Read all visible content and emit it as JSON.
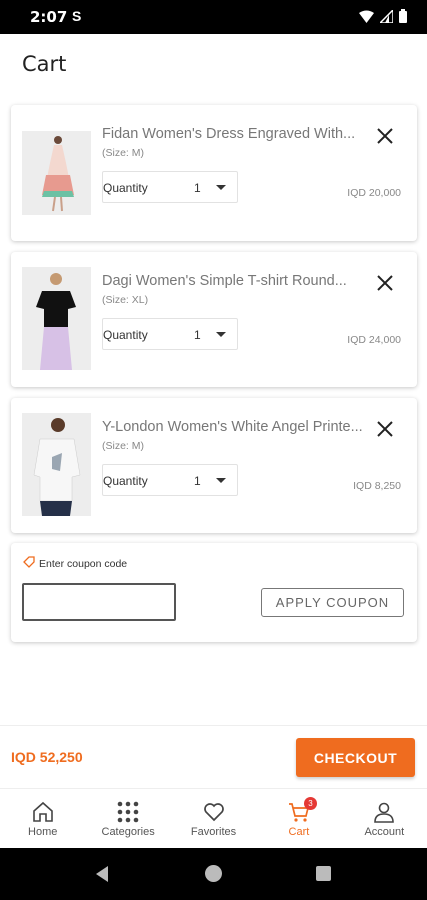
{
  "status_bar": {
    "time": "2:07",
    "notification_icon": "S"
  },
  "page": {
    "title": "Cart"
  },
  "cart": {
    "items": [
      {
        "name": "Fidan Women's Dress Engraved With...",
        "size": "(Size: M)",
        "quantity_label": "Quantity",
        "quantity": "1",
        "price": "IQD 20,000"
      },
      {
        "name": "Dagi Women's Simple T-shirt Round...",
        "size": "(Size: XL)",
        "quantity_label": "Quantity",
        "quantity": "1",
        "price": "IQD 24,000"
      },
      {
        "name": "Y-London Women's White Angel Printe...",
        "size": "(Size: M)",
        "quantity_label": "Quantity",
        "quantity": "1",
        "price": "IQD 8,250"
      }
    ]
  },
  "coupon": {
    "label": "Enter coupon code",
    "value": "",
    "apply_label": "APPLY COUPON"
  },
  "checkout": {
    "total": "IQD 52,250",
    "button_label": "CHECKOUT"
  },
  "bottom_nav": {
    "items": [
      {
        "label": "Home",
        "icon": "home-icon"
      },
      {
        "label": "Categories",
        "icon": "grid-icon"
      },
      {
        "label": "Favorites",
        "icon": "heart-icon"
      },
      {
        "label": "Cart",
        "icon": "cart-icon",
        "badge": "3",
        "active": true
      },
      {
        "label": "Account",
        "icon": "user-icon"
      }
    ]
  },
  "colors": {
    "accent": "#ef6c1f",
    "badge": "#e53935"
  }
}
